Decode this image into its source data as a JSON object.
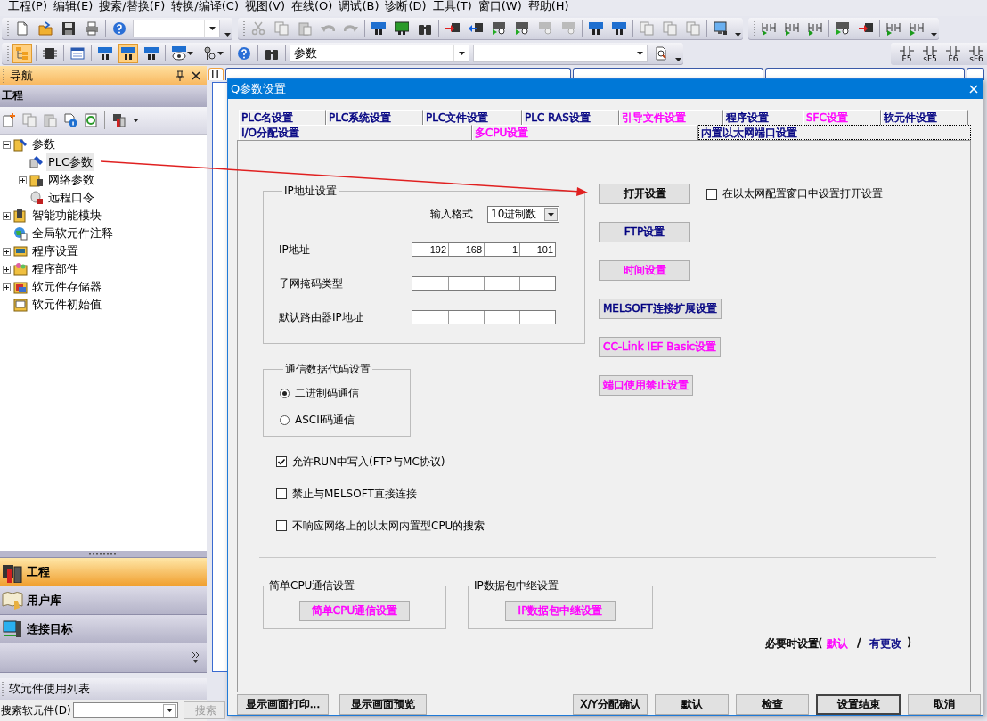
{
  "menu": [
    "工程(P)",
    "编辑(E)",
    "搜索/替换(F)",
    "转换/编译(C)",
    "视图(V)",
    "在线(O)",
    "调试(B)",
    "诊断(D)",
    "工具(T)",
    "窗口(W)",
    "帮助(H)"
  ],
  "toolbar": {
    "combo_value": "参数"
  },
  "ladder_keys": [
    "F5",
    "sF5",
    "F6",
    "sF6"
  ],
  "editor": {
    "tabs": [
      {
        "label": "IT",
        "selected": true
      },
      {
        "selected": false
      },
      {
        "selected": false
      },
      {
        "selected": false
      },
      {
        "selected": false
      }
    ]
  },
  "navigation": {
    "title": "导航",
    "section": "工程",
    "tree": [
      {
        "label": "参数",
        "expanded": true,
        "selected": false,
        "children": [
          {
            "label": "PLC参数",
            "selected": true
          },
          {
            "label": "网络参数",
            "expanded": false,
            "selected": false
          },
          {
            "label": "远程口令",
            "selected": false
          }
        ]
      },
      {
        "label": "智能功能模块",
        "expanded": false,
        "selected": false
      },
      {
        "label": "全局软元件注释",
        "selected": false
      },
      {
        "label": "程序设置",
        "expanded": false,
        "selected": false
      },
      {
        "label": "程序部件",
        "expanded": false,
        "selected": false
      },
      {
        "label": "软元件存储器",
        "expanded": false,
        "selected": false
      },
      {
        "label": "软元件初始值",
        "selected": false
      }
    ],
    "buttons": [
      {
        "label": "工程",
        "selected": true
      },
      {
        "label": "用户库",
        "selected": false
      },
      {
        "label": "连接目标",
        "selected": false
      }
    ]
  },
  "device_list": {
    "title": "软元件使用列表",
    "search_label": "搜索软元件(D)",
    "search_button": {
      "label": "搜索",
      "disabled": true
    }
  },
  "dialog": {
    "title": "Q参数设置",
    "tab_rows": [
      [
        {
          "label": "PLC名设置",
          "selected": false,
          "color": "#000080"
        },
        {
          "label": "PLC系统设置",
          "selected": false,
          "color": "#000080"
        },
        {
          "label": "PLC文件设置",
          "selected": false,
          "color": "#000080"
        },
        {
          "label": "PLC RAS设置",
          "selected": false,
          "color": "#000080"
        },
        {
          "label": "引导文件设置",
          "selected": false,
          "color": "#ff00ff"
        },
        {
          "label": "程序设置",
          "selected": false,
          "color": "#000080"
        },
        {
          "label": "SFC设置",
          "selected": false,
          "color": "#ff00ff"
        },
        {
          "label": "软元件设置",
          "selected": false,
          "color": "#000080"
        }
      ],
      [
        {
          "label": "I/O分配设置",
          "selected": false,
          "color": "#000080"
        },
        {
          "label": "多CPU设置",
          "selected": false,
          "color": "#ff00ff"
        },
        {
          "label": "内置以太网端口设置",
          "selected": true,
          "color": "#000080"
        }
      ]
    ],
    "ip_settings": {
      "title": "IP地址设置",
      "format_label": "输入格式",
      "format_value": "10进制数",
      "rows": [
        {
          "label": "IP地址",
          "octets": [
            "192",
            "168",
            "1",
            "101"
          ]
        },
        {
          "label": "子网掩码类型"
        },
        {
          "label": "默认路由器IP地址"
        }
      ]
    },
    "code_settings": {
      "title": "通信数据代码设置",
      "options": [
        {
          "label": "二进制码通信",
          "selected": true
        },
        {
          "label": "ASCII码通信",
          "selected": false
        }
      ]
    },
    "options": [
      {
        "label": "允许RUN中写入(FTP与MC协议)",
        "checked": true
      },
      {
        "label": "禁止与MELSOFT直接连接",
        "checked": false
      },
      {
        "label": "不响应网络上的以太网内置型CPU的搜索",
        "checked": false
      }
    ],
    "side_buttons": [
      {
        "label": "打开设置",
        "color": "#000000"
      },
      {
        "label": "FTP设置",
        "color": "#000080"
      },
      {
        "label": "时间设置",
        "color": "#ff00ff"
      },
      {
        "label": "MELSOFT连接扩展设置",
        "color": "#000080"
      },
      {
        "label": "CC-Link IEF Basic设置",
        "color": "#ff00ff"
      },
      {
        "label": "端口使用禁止设置",
        "color": "#ff00ff"
      }
    ],
    "open_in_ethernet": {
      "label": "在以太网配置窗口中设置打开设置",
      "checked": false
    },
    "groups": [
      {
        "title": "简单CPU通信设置",
        "button": {
          "label": "简单CPU通信设置",
          "color": "#ff00ff"
        }
      },
      {
        "title": "IP数据包中继设置",
        "button": {
          "label": "IP数据包中继设置",
          "color": "#ff00ff"
        }
      }
    ],
    "note": {
      "text": "必要时设置(",
      "legend": [
        {
          "text": "默认",
          "color": "#ff00ff"
        },
        {
          "text": "有更改",
          "color": "#000080"
        }
      ],
      "separator": "/",
      "close": ")"
    },
    "buttons": [
      {
        "label": "显示画面打印...",
        "default": false
      },
      {
        "label": "显示画面预览",
        "default": false
      },
      {
        "label": "X/Y分配确认",
        "default": false
      },
      {
        "label": "默认",
        "default": false
      },
      {
        "label": "检查",
        "default": false
      },
      {
        "label": "设置结束",
        "default": true
      },
      {
        "label": "取消",
        "default": false
      }
    ]
  }
}
